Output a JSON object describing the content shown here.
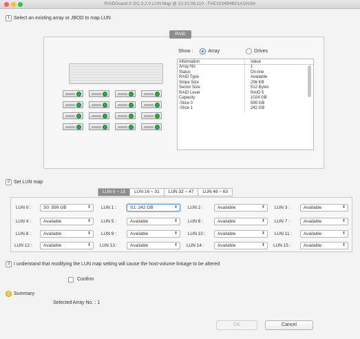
{
  "window": {
    "title": "RAIDGuard X GC.3.2.0 LUN Map @ 10.10.08.110 - FAE1024B4B01A1916A"
  },
  "colors": {
    "close": "#ff5f57",
    "minimize": "#febc2e",
    "zoom": "#28c840",
    "accent": "#3d7bd9",
    "led_green": "#2aa84a"
  },
  "step1": {
    "num": "1",
    "label": "Select an existing array or JBOD to map LUN"
  },
  "raid_panel": {
    "tab_label": "RAID",
    "show_label": "Show :",
    "option_array": "Array",
    "option_drives": "Drives",
    "table_headers": {
      "info": "Information",
      "value": "Value"
    },
    "rows": [
      {
        "info": "Array No",
        "value": "1"
      },
      {
        "info": "Status",
        "value": "On-line"
      },
      {
        "info": "RAID Type",
        "value": "Available"
      },
      {
        "info": "Stripe Size",
        "value": "256 KB"
      },
      {
        "info": "Sector Size",
        "value": "512 Bytes"
      },
      {
        "info": "RAID Level",
        "value": "RAID 5"
      },
      {
        "info": "Capacity",
        "value": "1024 GB"
      },
      {
        "info": "-Slice 0",
        "value": "599 GB"
      },
      {
        "info": "-Slice 1",
        "value": "242 GB"
      }
    ]
  },
  "step2": {
    "num": "2",
    "label": "Set LUN map",
    "tabs": [
      "LUN 0 ~ 15",
      "LUN 16 ~ 31",
      "LUN 32 ~ 47",
      "LUN 48 ~ 63"
    ],
    "luns": [
      {
        "label": "LUN 0 :",
        "value": "S0: 599 GB"
      },
      {
        "label": "LUN 1 :",
        "value": "S1: 242 GB"
      },
      {
        "label": "LUN 2 :",
        "value": "Available"
      },
      {
        "label": "LUN 3 :",
        "value": "Available"
      },
      {
        "label": "LUN 4 :",
        "value": "Available"
      },
      {
        "label": "LUN 5 :",
        "value": "Available"
      },
      {
        "label": "LUN 6 :",
        "value": "Available"
      },
      {
        "label": "LUN 7 :",
        "value": "Available"
      },
      {
        "label": "LUN 8 :",
        "value": "Available"
      },
      {
        "label": "LUN 9 :",
        "value": "Available"
      },
      {
        "label": "LUN 10 :",
        "value": "Available"
      },
      {
        "label": "LUN 11 :",
        "value": "Available"
      },
      {
        "label": "LUN 12 :",
        "value": "Available"
      },
      {
        "label": "LUN 13 :",
        "value": "Available"
      },
      {
        "label": "LUN 14 :",
        "value": "Available"
      },
      {
        "label": "LUN 15 :",
        "value": "Available"
      }
    ]
  },
  "step3": {
    "num": "3",
    "label": "I understand that modifying the LUN map setting will cause the host-volume linkage to be altered",
    "confirm_label": "Confirm"
  },
  "summary": {
    "num": "!",
    "label": "Summary",
    "selected_text": "Selected Array No. : 1"
  },
  "buttons": {
    "ok": "OK",
    "cancel": "Cancel"
  }
}
